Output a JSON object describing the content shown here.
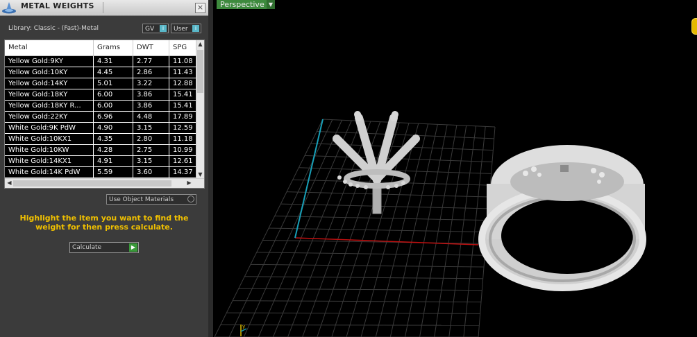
{
  "panel": {
    "title": "METAL WEIGHTS",
    "close": "×",
    "library": "Library: Classic - (Fast)-Metal",
    "gv_label": "GV",
    "user_label": "User",
    "table": {
      "headers": [
        "Metal",
        "Grams",
        "DWT",
        "SPG"
      ],
      "rows": [
        [
          "Yellow Gold:9KY",
          "4.31",
          "2.77",
          "11.08"
        ],
        [
          "Yellow Gold:10KY",
          "4.45",
          "2.86",
          "11.43"
        ],
        [
          "Yellow Gold:14KY",
          "5.01",
          "3.22",
          "12.88"
        ],
        [
          "Yellow Gold:18KY",
          "6.00",
          "3.86",
          "15.41"
        ],
        [
          "Yellow Gold:18KY R...",
          "6.00",
          "3.86",
          "15.41"
        ],
        [
          "Yellow Gold:22KY",
          "6.96",
          "4.48",
          "17.89"
        ],
        [
          "White Gold:9K PdW",
          "4.90",
          "3.15",
          "12.59"
        ],
        [
          "White Gold:10KX1",
          "4.35",
          "2.80",
          "11.18"
        ],
        [
          "White Gold:10KW",
          "4.28",
          "2.75",
          "10.99"
        ],
        [
          "White Gold:14KX1",
          "4.91",
          "3.15",
          "12.61"
        ],
        [
          "White Gold:14K PdW",
          "5.59",
          "3.60",
          "14.37"
        ]
      ]
    },
    "use_object_materials": "Use Object Materials",
    "hint": "Highlight the item you want to find the weight for then press calculate.",
    "calculate": "Calculate"
  },
  "viewport": {
    "view_label": "Perspective"
  },
  "colors": {
    "hint": "#f0c000",
    "perspective": "#3d8a3d",
    "x_axis": "#c01010",
    "y_axis": "#18a0b8"
  }
}
